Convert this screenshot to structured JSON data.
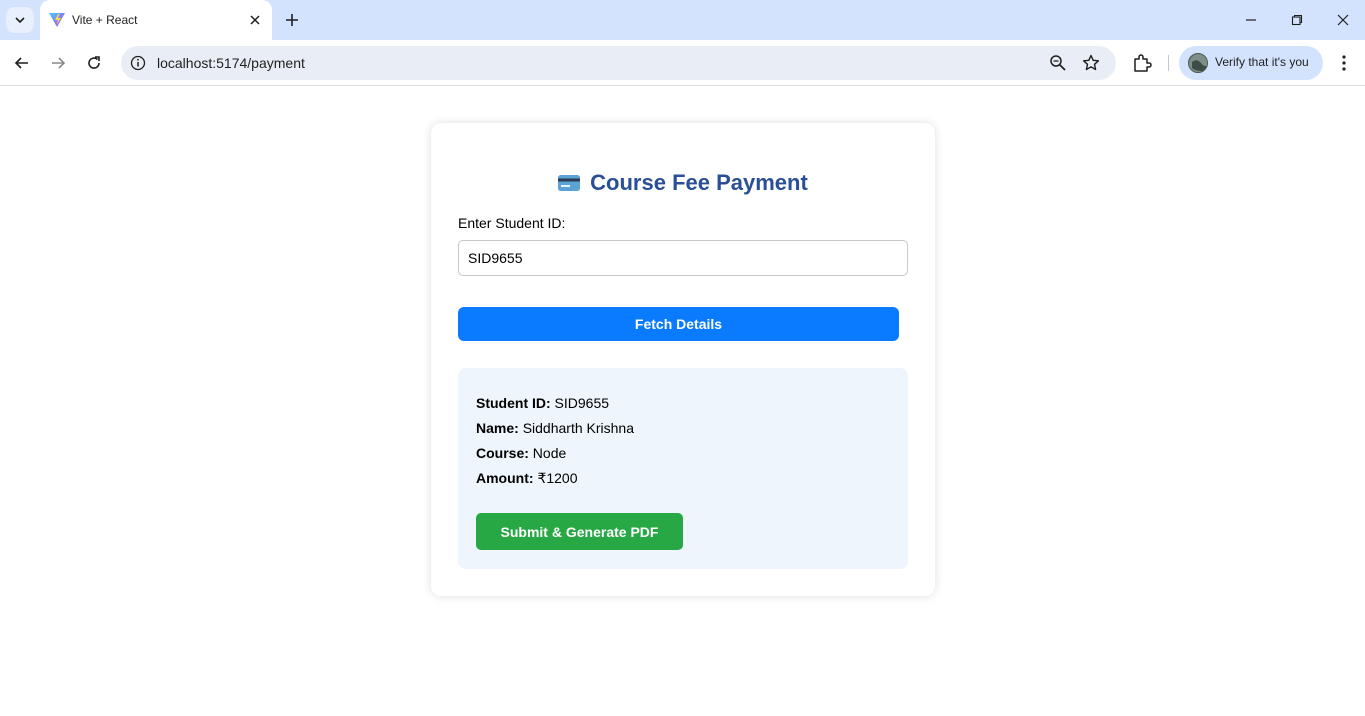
{
  "browser": {
    "tab_title": "Vite + React",
    "url": "localhost:5174/payment",
    "profile_label": "Verify that it's you"
  },
  "page": {
    "heading": "Course Fee Payment",
    "heading_icon": "credit-card-icon",
    "student_id_label": "Enter Student ID:",
    "student_id_value": "SID9655",
    "fetch_button": "Fetch Details",
    "details": {
      "student_id_label": "Student ID:",
      "student_id": "SID9655",
      "name_label": "Name:",
      "name": "Siddharth Krishna",
      "course_label": "Course:",
      "course": "Node",
      "amount_label": "Amount:",
      "amount": "₹1200"
    },
    "submit_button": "Submit & Generate PDF"
  },
  "colors": {
    "heading": "#2a4f96",
    "fetch_button": "#0a7bff",
    "submit_button": "#28a745",
    "details_bg": "#eef5fc",
    "tabbar_bg": "#d3e3fd"
  }
}
